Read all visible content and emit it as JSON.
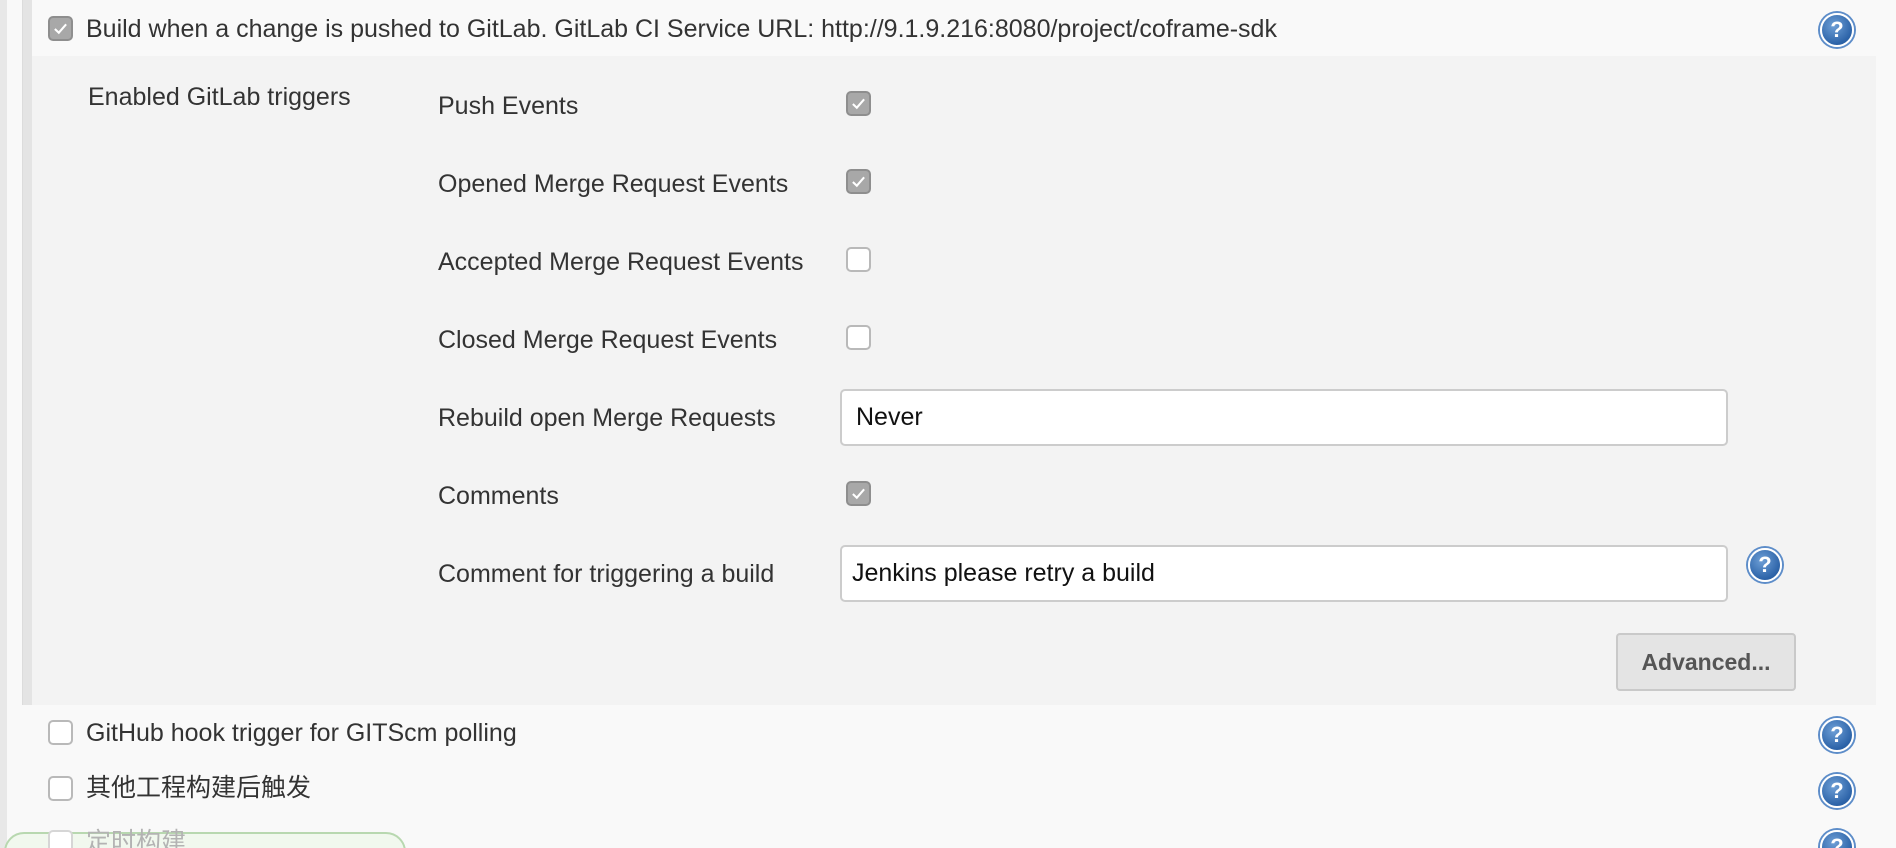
{
  "gitlab_trigger": {
    "checked": true,
    "label": "Build when a change is pushed to GitLab. GitLab CI Service URL: http://9.1.9.216:8080/project/coframe-sdk",
    "section_title": "Enabled GitLab triggers",
    "options": [
      {
        "label": "Push Events",
        "checked": true
      },
      {
        "label": "Opened Merge Request Events",
        "checked": true
      },
      {
        "label": "Accepted Merge Request Events",
        "checked": false
      },
      {
        "label": "Closed Merge Request Events",
        "checked": false
      }
    ],
    "rebuild": {
      "label": "Rebuild open Merge Requests",
      "value": "Never"
    },
    "comments": {
      "label": "Comments",
      "checked": true
    },
    "comment_trigger": {
      "label": "Comment for triggering a build",
      "value": "Jenkins please retry a build"
    },
    "advanced_label": "Advanced..."
  },
  "other_triggers": [
    {
      "label": "GitHub hook trigger for GITScm polling",
      "checked": false
    },
    {
      "label": "其他工程构建后触发",
      "checked": false
    },
    {
      "label": "定时构建",
      "checked": false
    }
  ],
  "help_icon_glyph": "?",
  "colors": {
    "help_icon": "#2c63a8",
    "checkbox_checked": "#a8a8a8",
    "panel_bg": "#f3f3f3"
  }
}
